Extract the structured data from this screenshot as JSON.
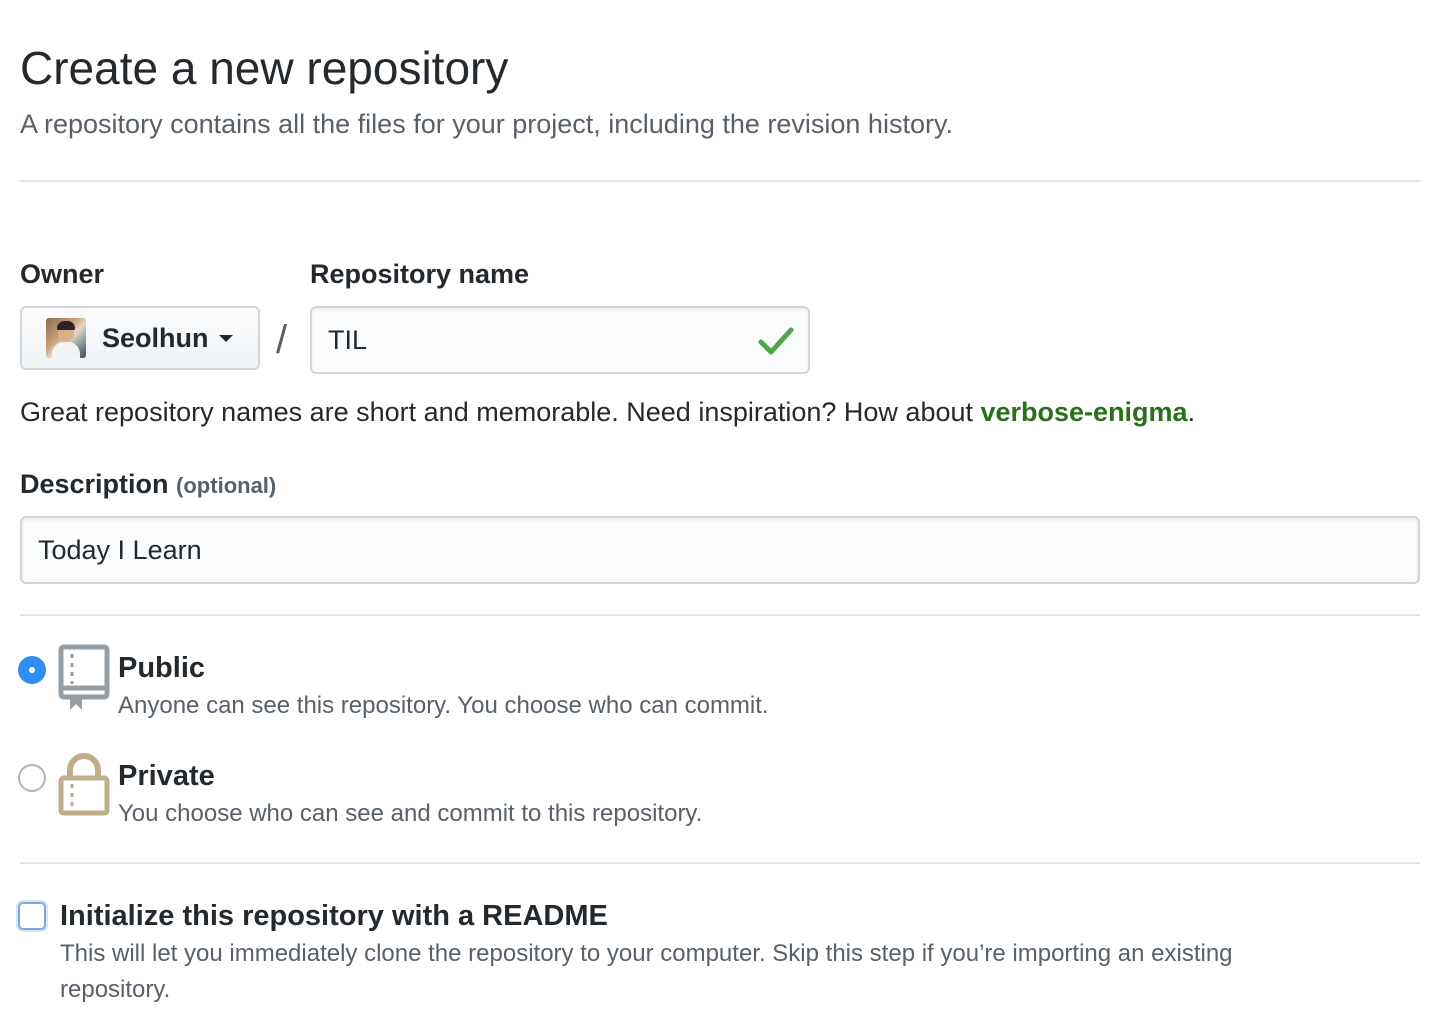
{
  "header": {
    "title": "Create a new repository",
    "subtitle": "A repository contains all the files for your project, including the revision history."
  },
  "owner": {
    "label": "Owner",
    "name": "Seolhun"
  },
  "separator": "/",
  "repo": {
    "label": "Repository name",
    "value": "TIL",
    "status": "valid"
  },
  "hint": {
    "text": "Great repository names are short and memorable. Need inspiration? How about ",
    "suggestion": "verbose-enigma",
    "suffix": "."
  },
  "description": {
    "label": "Description",
    "optional": "(optional)",
    "value": "Today I Learn"
  },
  "visibility": {
    "selected": "public",
    "public": {
      "title": "Public",
      "desc": "Anyone can see this repository. You choose who can commit.",
      "icon": "repo-icon"
    },
    "private": {
      "title": "Private",
      "desc": "You choose who can see and commit to this repository.",
      "icon": "lock-icon"
    }
  },
  "readme": {
    "checked": false,
    "title": "Initialize this repository with a README",
    "desc_line1": "This will let you immediately clone the repository to your computer. Skip this step if you’re importing an existing",
    "desc_line2": "repository."
  },
  "colors": {
    "link_green": "#2c6e1e",
    "check_green": "#4fa54a",
    "radio_blue": "#2f8ef4",
    "muted": "#586069"
  }
}
